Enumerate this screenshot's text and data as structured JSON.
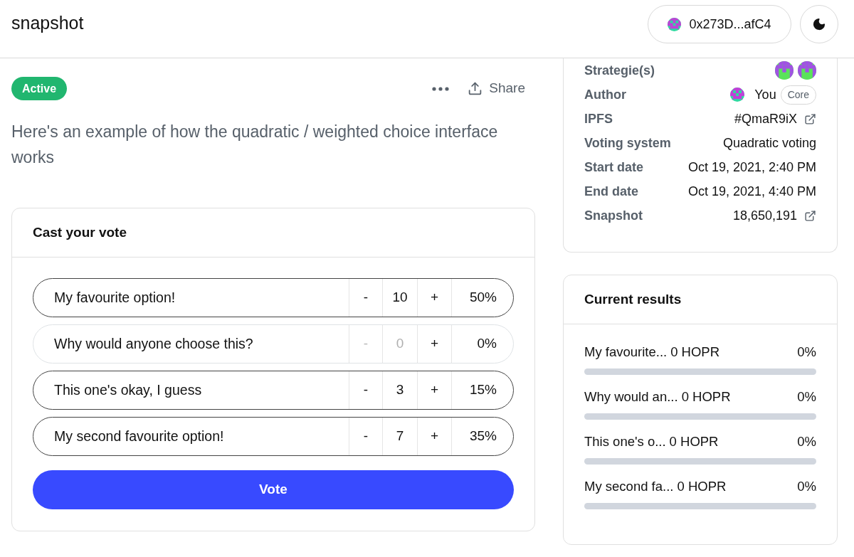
{
  "header": {
    "logo": "snapshot",
    "account": {
      "address": "0x273D...afC4"
    }
  },
  "proposal": {
    "status": "Active",
    "share": "Share",
    "body": "Here's an example of how the quadratic / weighted choice interface works"
  },
  "vote_card": {
    "title": "Cast your vote",
    "choices": [
      {
        "label": "My favourite option!",
        "minus": "-",
        "count": "10",
        "plus": "+",
        "percent": "50%",
        "active": true
      },
      {
        "label": "Why would anyone choose this?",
        "minus": "-",
        "count": "0",
        "plus": "+",
        "percent": "0%",
        "active": false
      },
      {
        "label": "This one's okay, I guess",
        "minus": "-",
        "count": "3",
        "plus": "+",
        "percent": "15%",
        "active": true
      },
      {
        "label": "My second favourite option!",
        "minus": "-",
        "count": "7",
        "plus": "+",
        "percent": "35%",
        "active": true
      }
    ],
    "button": "Vote"
  },
  "info_card": {
    "rows": [
      {
        "kind": "avatars",
        "label": "Strategie(s)"
      },
      {
        "kind": "author",
        "label": "Author",
        "value": "You",
        "badge": "Core"
      },
      {
        "kind": "link",
        "label": "IPFS",
        "value": "#QmaR9iX"
      },
      {
        "kind": "text",
        "label": "Voting system",
        "value": "Quadratic voting"
      },
      {
        "kind": "text",
        "label": "Start date",
        "value": "Oct 19, 2021, 2:40 PM"
      },
      {
        "kind": "text",
        "label": "End date",
        "value": "Oct 19, 2021, 4:40 PM"
      },
      {
        "kind": "link",
        "label": "Snapshot",
        "value": "18,650,191"
      }
    ]
  },
  "results_card": {
    "title": "Current results",
    "items": [
      {
        "label": "My favourite...",
        "score": "0 HOPR",
        "percent": "0%"
      },
      {
        "label": "Why would an...",
        "score": "0 HOPR",
        "percent": "0%"
      },
      {
        "label": "This one's o...",
        "score": "0 HOPR",
        "percent": "0%"
      },
      {
        "label": "My second fa...",
        "score": "0 HOPR",
        "percent": "0%"
      }
    ]
  }
}
